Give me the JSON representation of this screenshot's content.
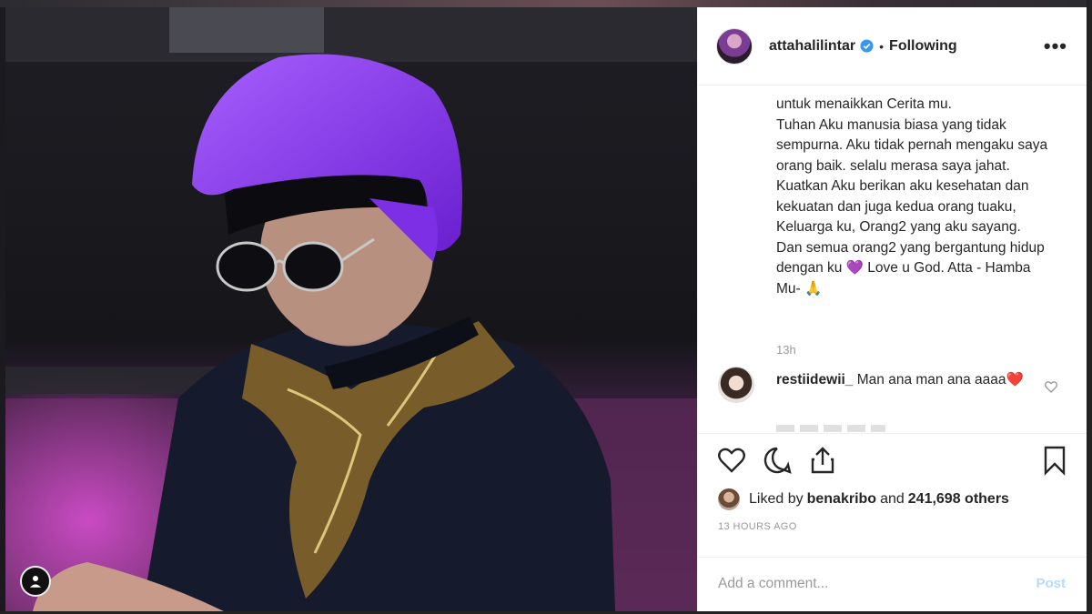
{
  "post": {
    "username": "attahalilintar",
    "following": "Following",
    "separator": "•",
    "more": "•••"
  },
  "caption": {
    "text": "untuk menaikkan Cerita mu.\nTuhan Aku manusia biasa yang tidak sempurna. Aku tidak pernah mengaku saya orang baik. selalu merasa saya jahat. Kuatkan Aku berikan aku kesehatan dan kekuatan dan juga kedua orang tuaku, Keluarga ku, Orang2 yang aku sayang. Dan semua orang2 yang bergantung hidup dengan ku 💜 Love u God. Atta - Hamba Mu- 🙏",
    "time": "13h"
  },
  "comment": {
    "user": "restiidewii_",
    "text": "Man ana man ana aaaa❤️"
  },
  "likes": {
    "prefix": "Liked by",
    "user": "benakribo",
    "and": "and",
    "count": "241,698 others"
  },
  "timestamp": "13 HOURS AGO",
  "add_comment": {
    "placeholder": "Add a comment...",
    "post": "Post"
  },
  "colors": {
    "hair": "#7b2fe0",
    "verified": "#3897f0",
    "post_disabled": "#b3dbff"
  },
  "icons": [
    "verified-badge-icon",
    "more-options-icon",
    "heart-icon",
    "comment-icon",
    "share-icon",
    "bookmark-icon",
    "user-icon"
  ]
}
